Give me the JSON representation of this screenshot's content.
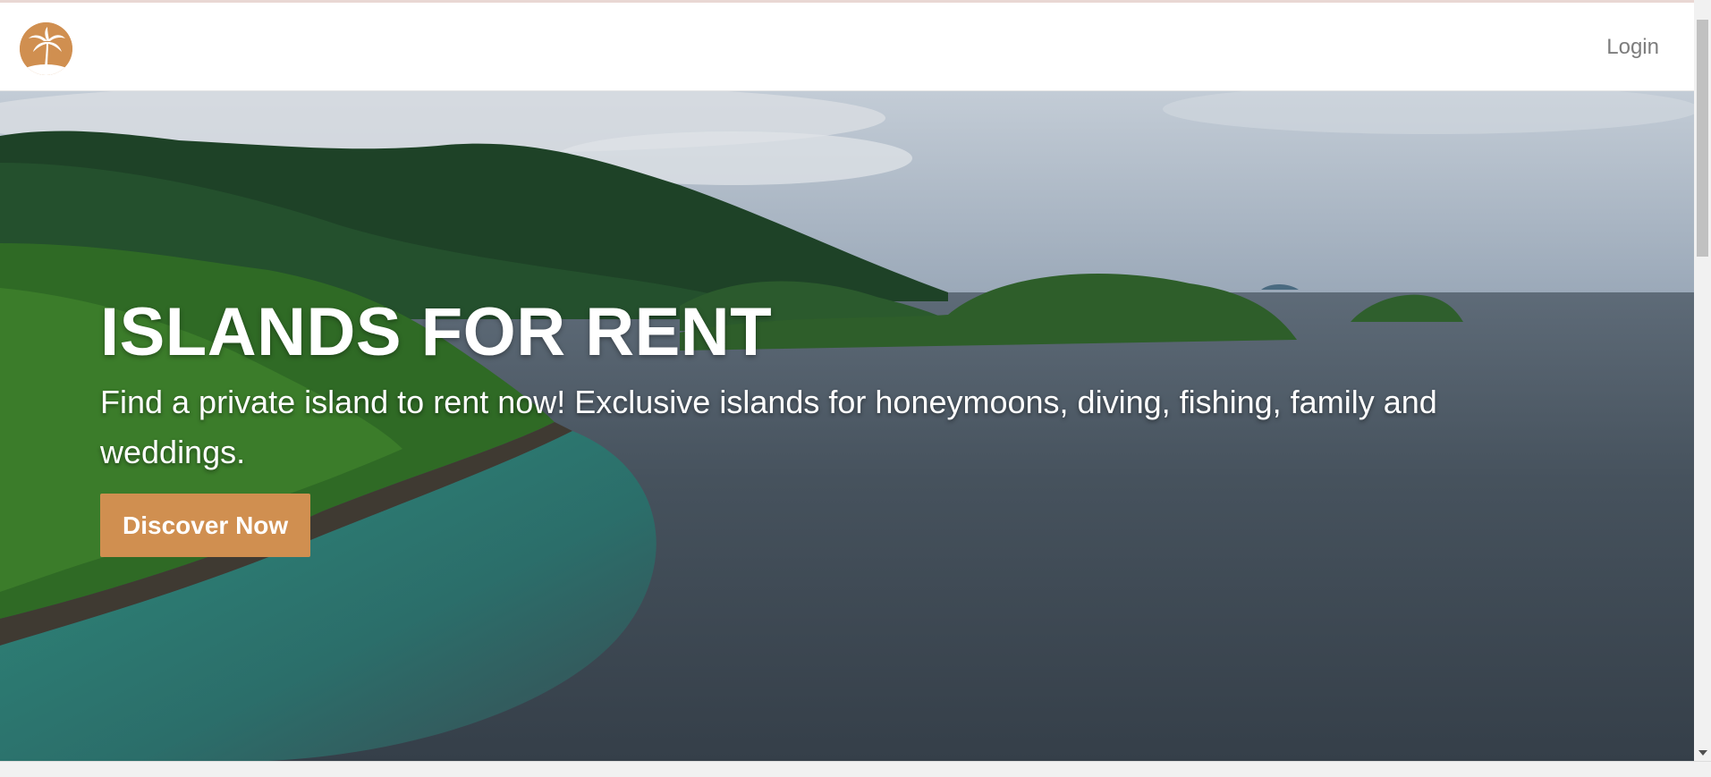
{
  "navbar": {
    "logo_icon": "palm-tree-icon",
    "login_label": "Login"
  },
  "hero": {
    "title": "ISLANDS FOR RENT",
    "subtitle": "Find a private island to rent now! Exclusive islands for honeymoons, diving, fishing, family and weddings.",
    "cta_label": "Discover Now",
    "background_image": "aerial tropical islands and sea"
  },
  "colors": {
    "accent": "#d08f50",
    "nav_text": "#7d7d7d",
    "hero_text": "#ffffff"
  }
}
